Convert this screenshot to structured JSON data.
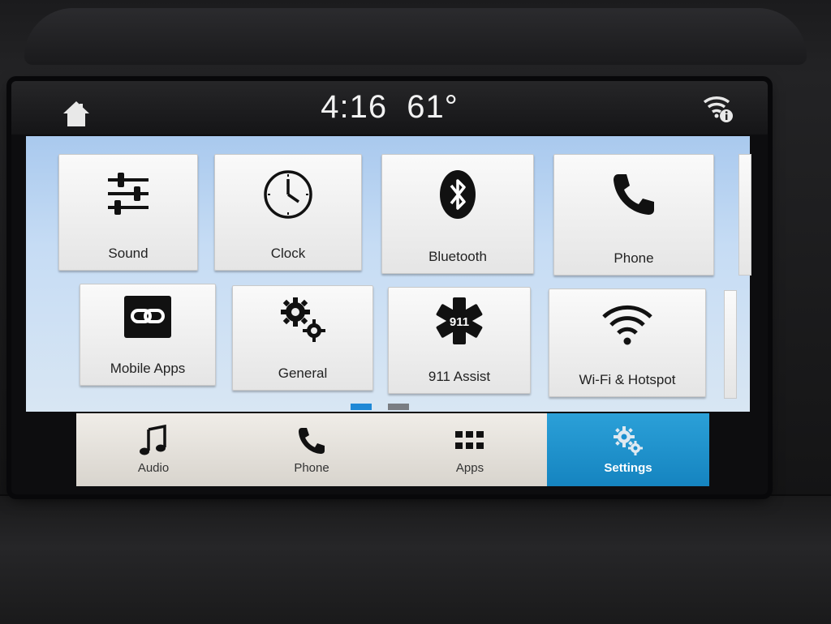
{
  "status_bar": {
    "time": "4:16",
    "temperature": "61°"
  },
  "tiles": [
    {
      "label": "Sound",
      "icon": "sliders-icon"
    },
    {
      "label": "Clock",
      "icon": "clock-icon"
    },
    {
      "label": "Bluetooth",
      "icon": "bluetooth-icon"
    },
    {
      "label": "Phone",
      "icon": "phone-icon"
    },
    {
      "label": "Mobile Apps",
      "icon": "mobile-apps-link-icon"
    },
    {
      "label": "General",
      "icon": "gears-icon"
    },
    {
      "label": "911 Assist",
      "icon": "star-of-life-911-icon",
      "badge": "911"
    },
    {
      "label": "Wi-Fi & Hotspot",
      "icon": "wifi-icon"
    }
  ],
  "pagination": {
    "current": 1,
    "total": 2,
    "active_color": "#1e88d6",
    "inactive_color": "#7a7d82"
  },
  "bottom_nav": [
    {
      "label": "Audio",
      "icon": "music-note-icon"
    },
    {
      "label": "Phone",
      "icon": "phone-icon"
    },
    {
      "label": "Apps",
      "icon": "apps-grid-icon"
    },
    {
      "label": "Settings",
      "icon": "gears-icon",
      "active": true
    }
  ],
  "colors": {
    "accent": "#1c90cf"
  }
}
